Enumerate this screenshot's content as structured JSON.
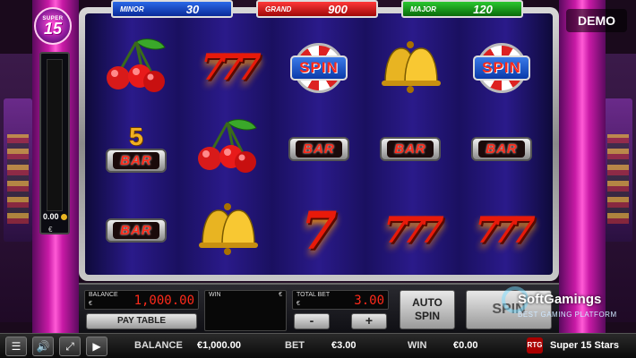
{
  "demo_label": "DEMO",
  "logo": {
    "top": "SUPER",
    "number": "15"
  },
  "jackpots": {
    "minor": {
      "label": "MINOR",
      "value": "30"
    },
    "grand": {
      "label": "GRAND",
      "value": "900"
    },
    "major": {
      "label": "MAJOR",
      "value": "120"
    }
  },
  "meter": {
    "value": "0.00",
    "currency": "€"
  },
  "reels": [
    [
      {
        "type": "cherries"
      },
      {
        "type": "777"
      },
      {
        "type": "spin",
        "label": "SPIN"
      },
      {
        "type": "bell"
      },
      {
        "type": "spin",
        "label": "SPIN"
      }
    ],
    [
      {
        "type": "5bar",
        "number": "5",
        "label": "BAR"
      },
      {
        "type": "cherries"
      },
      {
        "type": "bar",
        "label": "BAR"
      },
      {
        "type": "bar",
        "label": "BAR"
      },
      {
        "type": "bar",
        "label": "BAR"
      }
    ],
    [
      {
        "type": "bar",
        "label": "BAR"
      },
      {
        "type": "bell"
      },
      {
        "type": "seven",
        "label": "7"
      },
      {
        "type": "777",
        "label": "777"
      },
      {
        "type": "777",
        "label": "777"
      }
    ]
  ],
  "panel": {
    "balance_label": "BALANCE",
    "balance_currency": "€",
    "balance_value": "1,000.00",
    "paytable_label": "PAY TABLE",
    "win_label": "WIN",
    "win_currency": "€",
    "total_bet_label": "TOTAL BET",
    "total_bet_currency": "€",
    "total_bet_value": "3.00",
    "minus_label": "-",
    "plus_label": "+",
    "auto_spin_label_1": "AUTO",
    "auto_spin_label_2": "SPIN",
    "spin_label": "SPIN"
  },
  "bottom_bar": {
    "balance_label": "BALANCE",
    "balance_value": "€1,000.00",
    "bet_label": "BET",
    "bet_value": "€3.00",
    "win_label": "WIN",
    "win_value": "€0.00",
    "provider_badge": "RTG",
    "game_name": "Super 15 Stars"
  },
  "watermark": {
    "title": "SoftGamings",
    "subtitle": "BEST GAMING PLATFORM"
  }
}
